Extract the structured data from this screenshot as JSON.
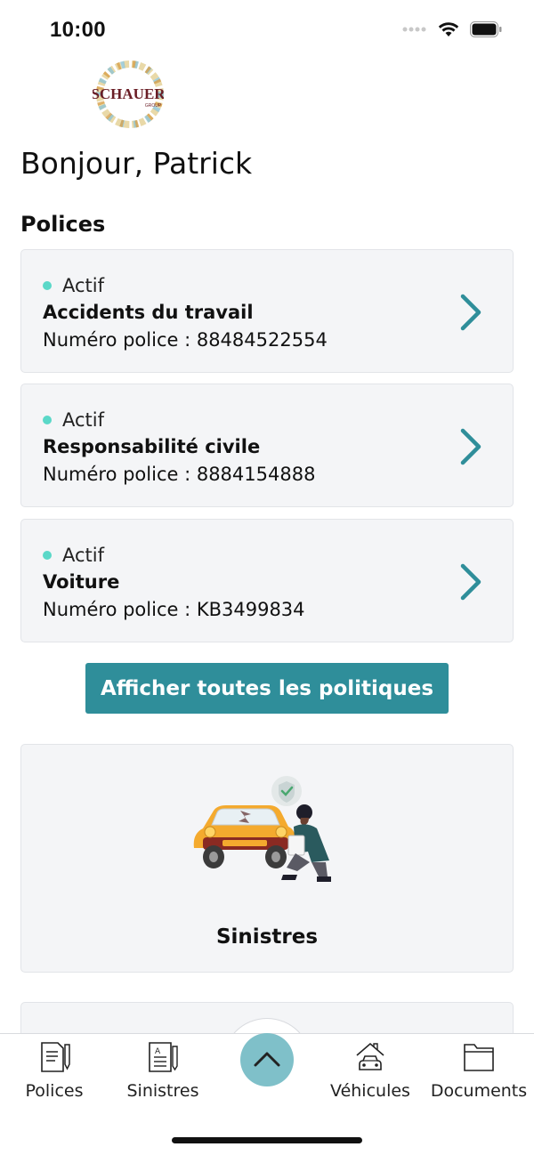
{
  "status_bar": {
    "time": "10:00"
  },
  "logo": {
    "text": "SCHAUER",
    "subtext": "GROUP"
  },
  "greeting": "Bonjour, Patrick",
  "policies": {
    "title": "Polices",
    "items": [
      {
        "status": "Actif",
        "name": "Accidents du travail",
        "number": "Numéro police : 88484522554"
      },
      {
        "status": "Actif",
        "name": "Responsabilité civile",
        "number": "Numéro police : 8884154888"
      },
      {
        "status": "Actif",
        "name": "Voiture",
        "number": "Numéro police : KB3499834"
      }
    ],
    "show_all_label": "Afficher toutes les politiques"
  },
  "claims_card": {
    "title": "Sinistres"
  },
  "tab_bar": {
    "items": [
      {
        "label": "Polices",
        "icon": "policy-document-icon"
      },
      {
        "label": "Sinistres",
        "icon": "claim-form-icon"
      },
      {
        "label": "Véhicules",
        "icon": "car-garage-icon"
      },
      {
        "label": "Documents",
        "icon": "folder-icon"
      }
    ],
    "center_icon": "chevron-up-icon"
  },
  "colors": {
    "accent": "#2f8e9a",
    "status_active": "#5ad8c8",
    "card_bg": "#f4f5f7",
    "fab": "#7fc0c9"
  }
}
